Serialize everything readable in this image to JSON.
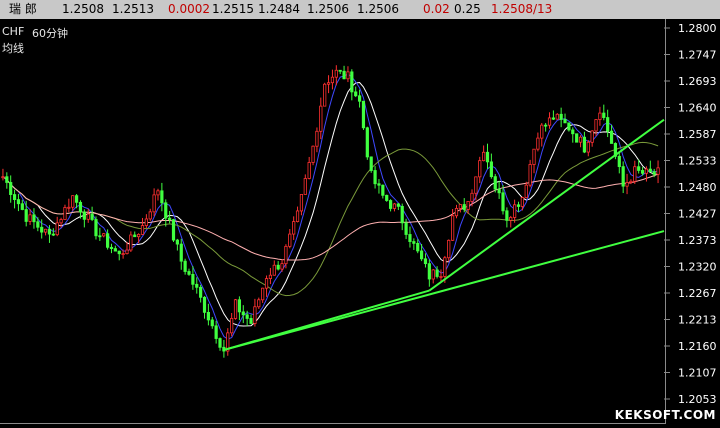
{
  "quote_bar": {
    "name": "瑞 郎",
    "fields": [
      "1.2508",
      "1.2513",
      "0.0002",
      "1.2515",
      "1.2484",
      "1.2506",
      "1.2506",
      "0.02",
      "0.25",
      "1.2508/13"
    ],
    "colors": [
      "#000000",
      "#000000",
      "#c00000",
      "#000000",
      "#000000",
      "#000000",
      "#000000",
      "#c00000",
      "#000000",
      "#c00000"
    ]
  },
  "panel": {
    "symbol": "CHF",
    "period": "60分钟",
    "indicator": "均线"
  },
  "watermark": "KEKSOFT.COM",
  "chart_data": {
    "type": "line",
    "title": "",
    "xlabel": "",
    "ylabel": "",
    "ylim": [
      1.2025,
      1.2825
    ],
    "y_ticks": [
      "1.2800",
      "1.2747",
      "1.2693",
      "1.2640",
      "1.2587",
      "1.2533",
      "1.2480",
      "1.2427",
      "1.2373",
      "1.2320",
      "1.2267",
      "1.2213",
      "1.2160",
      "1.2107",
      "1.2053"
    ],
    "candle_count": 170,
    "price_path": [
      [
        0,
        1.25
      ],
      [
        6,
        1.242
      ],
      [
        12,
        1.238
      ],
      [
        18,
        1.246
      ],
      [
        24,
        1.239
      ],
      [
        30,
        1.234
      ],
      [
        36,
        1.24
      ],
      [
        40,
        1.2475
      ],
      [
        46,
        1.233
      ],
      [
        50,
        1.227
      ],
      [
        54,
        1.22
      ],
      [
        57,
        1.215
      ],
      [
        60,
        1.224
      ],
      [
        64,
        1.2205
      ],
      [
        68,
        1.23
      ],
      [
        72,
        1.233
      ],
      [
        76,
        1.242
      ],
      [
        80,
        1.256
      ],
      [
        83,
        1.269
      ],
      [
        86,
        1.271
      ],
      [
        89,
        1.27
      ],
      [
        92,
        1.265
      ],
      [
        95,
        1.25
      ],
      [
        98,
        1.246
      ],
      [
        102,
        1.243
      ],
      [
        106,
        1.236
      ],
      [
        110,
        1.23
      ],
      [
        113,
        1.231
      ],
      [
        116,
        1.242
      ],
      [
        120,
        1.245
      ],
      [
        124,
        1.256
      ],
      [
        127,
        1.248
      ],
      [
        130,
        1.242
      ],
      [
        134,
        1.246
      ],
      [
        138,
        1.259
      ],
      [
        142,
        1.262
      ],
      [
        146,
        1.26
      ],
      [
        150,
        1.256
      ],
      [
        154,
        1.264
      ],
      [
        157,
        1.257
      ],
      [
        160,
        1.248
      ],
      [
        163,
        1.251
      ],
      [
        166,
        1.2505
      ],
      [
        169,
        1.2506
      ]
    ],
    "series": [
      {
        "color": "#ffffff",
        "period": 10
      },
      {
        "color": "#3f48ff",
        "period": 5
      },
      {
        "color": "#7a9a3a",
        "period": 30
      },
      {
        "color": "#ffb0b0",
        "period": 60
      }
    ],
    "trendlines": [
      {
        "color": "#40ff40",
        "from": [
          57,
          1.215
        ],
        "to": [
          110,
          1.227
        ]
      },
      {
        "color": "#40ff40",
        "from": [
          110,
          1.227
        ],
        "to": [
          172,
          1.2615
        ]
      },
      {
        "color": "#40ff40",
        "from": [
          57,
          1.215
        ],
        "to": [
          172,
          1.239
        ]
      }
    ],
    "colors": {
      "up": "#ff3030",
      "down": "#40ff40",
      "axis": "#8a8a8a",
      "tick_text": "#ffffff"
    },
    "grid": false,
    "legend": "none"
  }
}
